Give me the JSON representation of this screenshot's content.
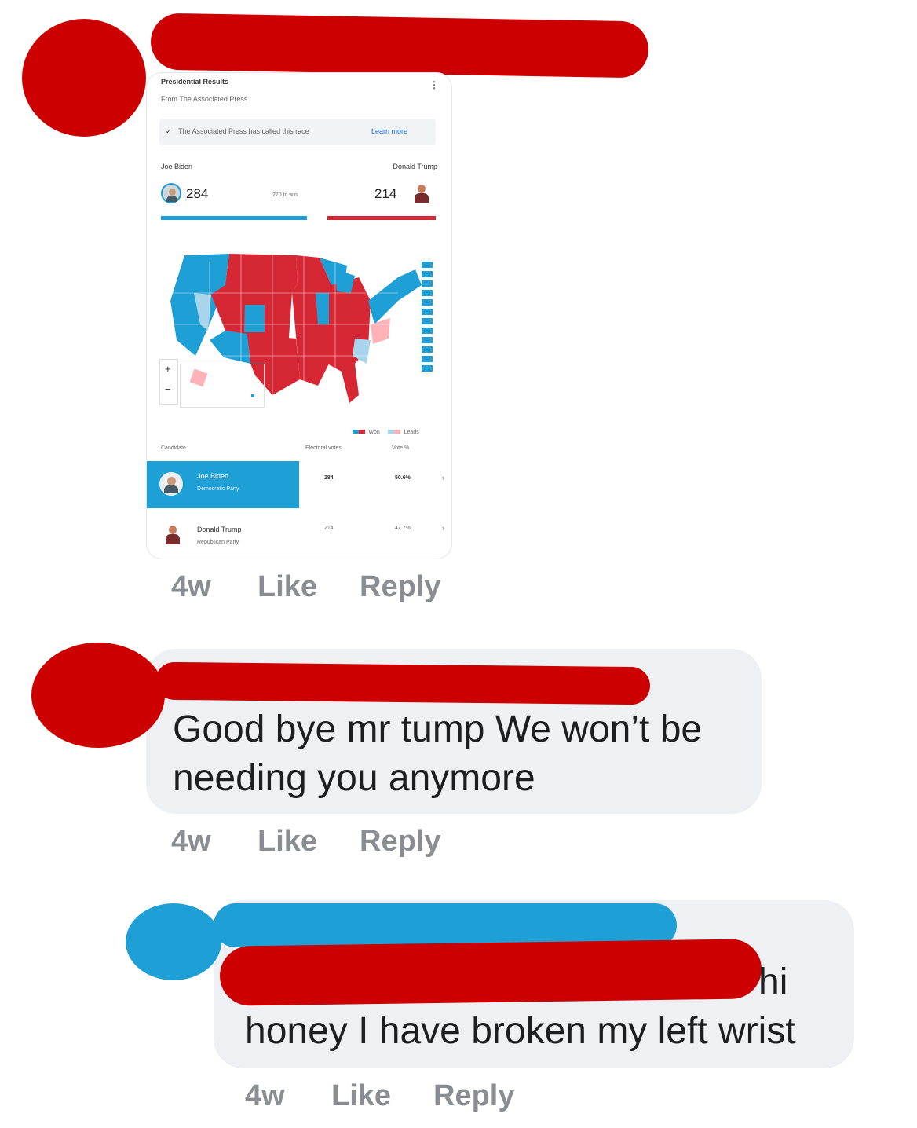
{
  "comments": [
    {
      "card": {
        "title": "Presidential Results",
        "source": "From The Associated Press",
        "banner": "The Associated Press has called this race",
        "banner_link": "Learn more",
        "candidate_left": "Joe Biden",
        "candidate_right": "Donald Trump",
        "votes_left": "284",
        "votes_right": "214",
        "to_win": "270 to win",
        "legend_won": "Won",
        "legend_leads": "Leads",
        "table_headers": [
          "Candidate",
          "Electoral votes",
          "Vote %"
        ],
        "rows": [
          {
            "name": "Joe Biden",
            "party": "Democratic Party",
            "electoral": "284",
            "percent": "50.6%"
          },
          {
            "name": "Donald Trump",
            "party": "Republican Party",
            "electoral": "214",
            "percent": "47.7%"
          }
        ],
        "zoom_in": "+",
        "zoom_out": "−"
      },
      "time": "4w",
      "like": "Like",
      "reply": "Reply"
    },
    {
      "text_line1": "Good bye mr tump We won’t be",
      "text_line2": "needing you anymore",
      "time": "4w",
      "like": "Like",
      "reply": "Reply"
    },
    {
      "text_tail": "hi",
      "text_line2": "honey I have broken my left wrist",
      "time": "4w",
      "like": "Like",
      "reply": "Reply"
    }
  ],
  "colors": {
    "redaction_red": "#cc0000",
    "redaction_blue": "#1e9fd6",
    "biden_blue": "#1e9fd6",
    "trump_red": "#d62734",
    "bubble_bg": "#eef0f3",
    "meta_gray": "#8a8d91"
  }
}
